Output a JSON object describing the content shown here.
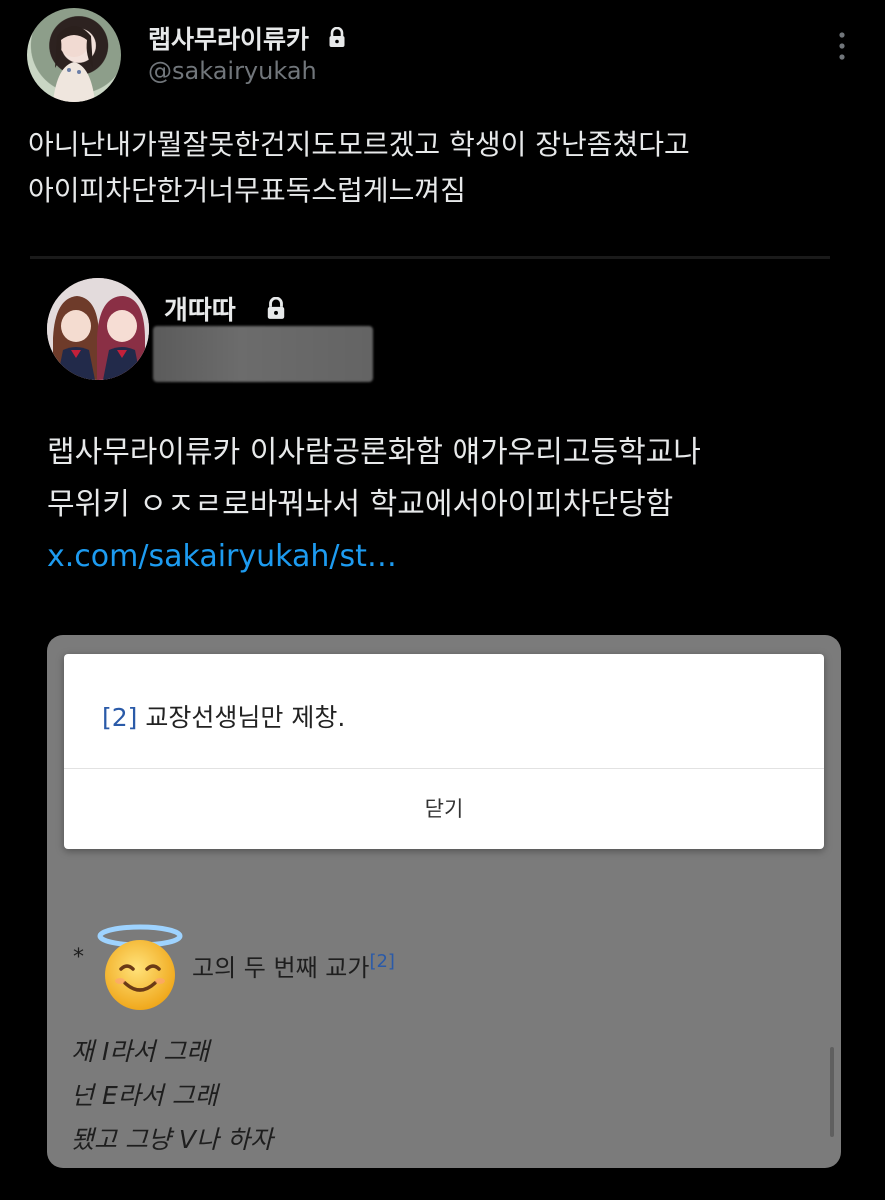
{
  "tweet": {
    "author_name": "랩사무라이류카",
    "author_handle": "@sakairyukah",
    "text_lines": [
      "아니난내가뭘잘못한건지도모르겠고 학생이 장난좀쳤다고",
      "아이피차단한거너무표독스럽게느껴짐"
    ],
    "more_icon": "vertical-ellipsis-icon",
    "lock_icon": "lock-icon"
  },
  "quote": {
    "author_name": "개따따",
    "handle_redacted": true,
    "text_lines": [
      "랩사무라이류카 이사람공론화함 얘가우리고등학교나",
      "무위키 ㅇㅈㄹ로바꿔놔서 학교에서아이피차단당함"
    ],
    "link": "x.com/sakairyukah/st…"
  },
  "screenshot": {
    "dialog": {
      "ref": "[2]",
      "message": "교장선생님만 제창.",
      "close_button": "닫기"
    },
    "footnote": {
      "prefix": "*",
      "text_visible": "고의 두 번째 교가",
      "ref": "[2]",
      "emoji": "😇"
    },
    "lyrics": [
      "재 I라서 그래",
      "넌 E라서 그래",
      "됐고 그냥 V나 하자"
    ]
  },
  "colors": {
    "background": "#000000",
    "text": "#e7e9ea",
    "secondary": "#71767b",
    "link": "#1d9bf0",
    "screenshot_gray": "#7b7b7b"
  }
}
